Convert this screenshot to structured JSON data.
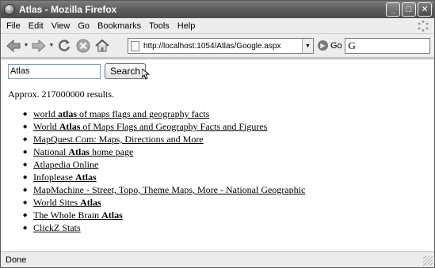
{
  "window": {
    "title": "Atlas - Mozilla Firefox"
  },
  "menu": [
    "File",
    "Edit",
    "View",
    "Go",
    "Bookmarks",
    "Tools",
    "Help"
  ],
  "address": {
    "url": "http://localhost:1054/Atlas/Google.aspx",
    "go_label": "Go"
  },
  "search_form": {
    "query": "Atlas",
    "button_label": "Search"
  },
  "results_count": "Approx. 217000000 results.",
  "results": [
    {
      "before": "world ",
      "bold": "atlas",
      "after": " of maps flags and geography facts"
    },
    {
      "before": "World ",
      "bold": "Atlas",
      "after": " of Maps Flags and Geography Facts and Figures"
    },
    {
      "before": "MapQuest.Com: Maps, Directions and More",
      "bold": "",
      "after": ""
    },
    {
      "before": "National ",
      "bold": "Atlas",
      "after": " home page"
    },
    {
      "before": "Atlapedia Online",
      "bold": "",
      "after": ""
    },
    {
      "before": "Infoplease ",
      "bold": "Atlas",
      "after": ""
    },
    {
      "before": "MapMachine - Street, Topo, Theme Maps, More - National Geographic",
      "bold": "",
      "after": ""
    },
    {
      "before": "World Sites ",
      "bold": "Atlas",
      "after": ""
    },
    {
      "before": "The Whole Brain ",
      "bold": "Atlas",
      "after": ""
    },
    {
      "before": "ClickZ Stats",
      "bold": "",
      "after": ""
    }
  ],
  "status": "Done",
  "icons": [
    "firefox-icon",
    "back-icon",
    "forward-icon",
    "reload-icon",
    "stop-icon",
    "home-icon",
    "page-icon",
    "go-icon",
    "google-icon",
    "throbber-icon"
  ]
}
